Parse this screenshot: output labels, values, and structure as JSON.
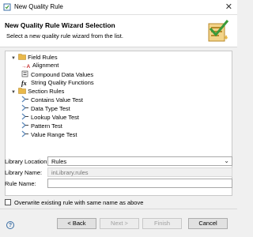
{
  "window": {
    "title": "New Quality Rule",
    "close_glyph": "✕"
  },
  "header": {
    "title": "New Quality Rule Wizard Selection",
    "subtitle": "Select a new quality rule wizard from the list."
  },
  "tree": {
    "groups": [
      {
        "label": "Field Rules",
        "expanded": true,
        "items": [
          {
            "label": "Alignment",
            "icon": "alignment-arrow-icon",
            "glyph": "→A"
          },
          {
            "label": "Compound Data Values",
            "icon": "compound-data-icon"
          },
          {
            "label": "String Quality Functions",
            "icon": "function-icon",
            "glyph": "fx"
          }
        ]
      },
      {
        "label": "Section Rules",
        "expanded": true,
        "items": [
          {
            "label": "Contains Value Test",
            "icon": "test-icon"
          },
          {
            "label": "Data Type Test",
            "icon": "test-icon"
          },
          {
            "label": "Lookup Value Test",
            "icon": "test-icon"
          },
          {
            "label": "Pattern Test",
            "icon": "test-icon"
          },
          {
            "label": "Value Range Test",
            "icon": "test-icon"
          }
        ]
      }
    ]
  },
  "form": {
    "library_location_label": "Library Location:",
    "library_location_value": "Rules",
    "library_name_label": "Library Name:",
    "library_name_value": "inLibrary.rules",
    "rule_name_label": "Rule Name:",
    "rule_name_value": "",
    "overwrite_label": "Overwrite existing rule with same name as above",
    "overwrite_checked": false
  },
  "buttons": {
    "help_glyph": "?",
    "back": "< Back",
    "next": "Next >",
    "finish": "Finish",
    "cancel": "Cancel"
  },
  "colors": {
    "folder": "#e8b84a",
    "test_icon": "#5b87b8",
    "accent_red": "#c83232"
  }
}
